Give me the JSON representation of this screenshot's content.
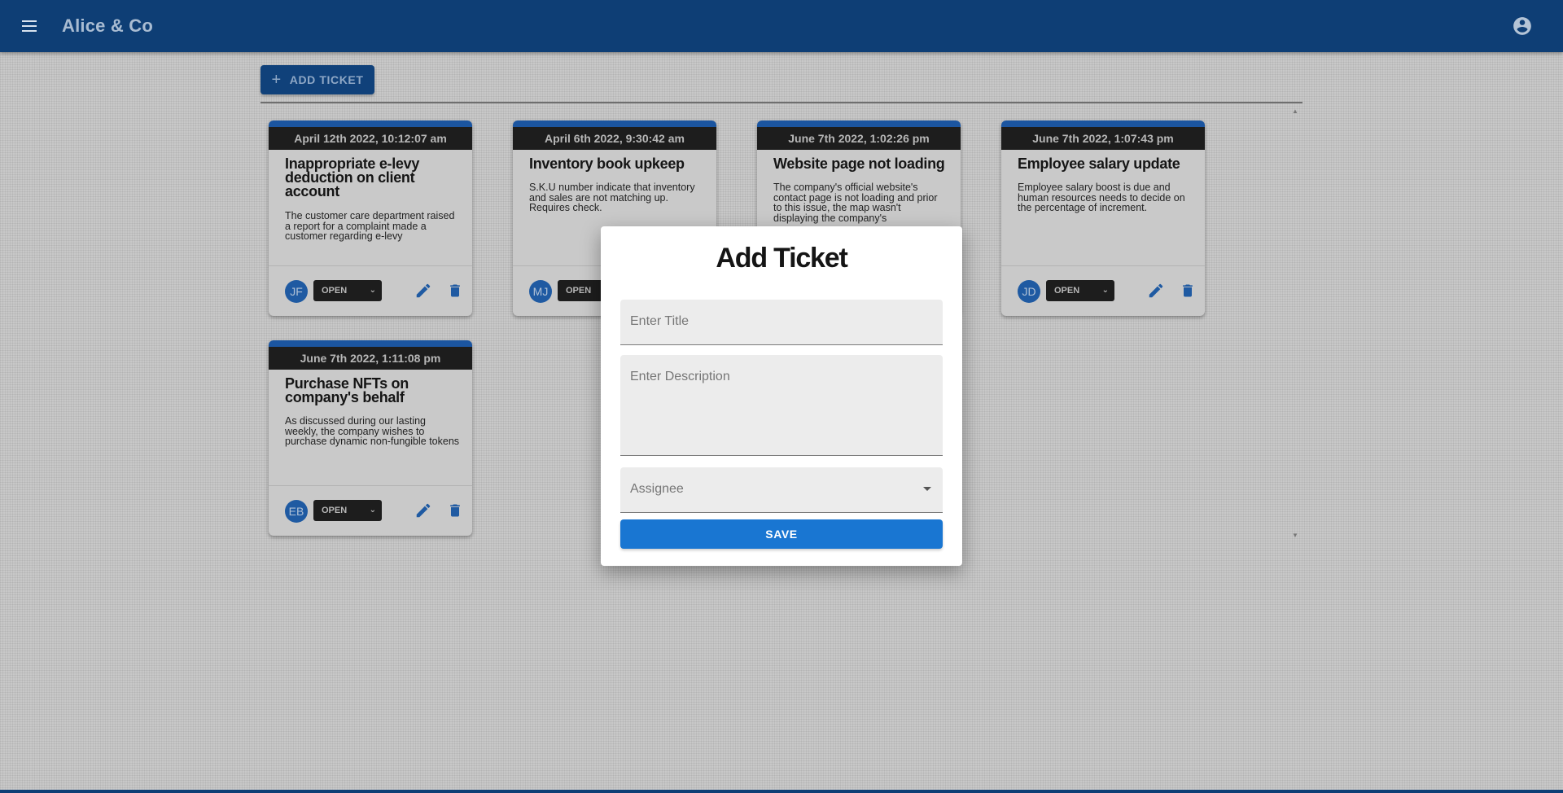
{
  "app": {
    "title": "Alice & Co",
    "menu_icon": "menu-icon",
    "account_icon": "account-circle-icon"
  },
  "toolbar": {
    "add_ticket_label": "ADD TICKET",
    "add_icon": "plus-icon"
  },
  "colors": {
    "appbar": "#0e3e75",
    "accent": "#1976d2",
    "card_accent": "#1b55a0",
    "dark_strip": "#1d1d1d"
  },
  "tickets": [
    {
      "date": "April 12th 2022, 10:12:07 am",
      "title": "Inappropriate e-levy deduction on client account",
      "description": "The customer care department raised a report for a complaint made a customer regarding e-levy",
      "assignee_initials": "JF",
      "status": "OPEN"
    },
    {
      "date": "April 6th 2022, 9:30:42 am",
      "title": "Inventory book upkeep",
      "description": "S.K.U number indicate that inventory and sales are not matching up. Requires check.",
      "assignee_initials": "MJ",
      "status": "OPEN"
    },
    {
      "date": "June 7th 2022, 1:02:26 pm",
      "title": "Website page not loading",
      "description": "The company's official website's contact page is not loading and prior to this issue, the map wasn't displaying the company's"
    },
    {
      "date": "June 7th 2022, 1:07:43 pm",
      "title": "Employee salary update",
      "description": "Employee salary boost is due and human resources needs to decide on the percentage of increment.",
      "assignee_initials": "JD",
      "status": "OPEN"
    },
    {
      "date": "June 7th 2022, 1:11:08 pm",
      "title": "Purchase NFTs on company's behalf",
      "description": "As discussed during our lasting weekly, the company wishes to purchase dynamic non-fungible tokens",
      "assignee_initials": "EB",
      "status": "OPEN"
    }
  ],
  "modal": {
    "title": "Add Ticket",
    "title_placeholder": "Enter Title",
    "description_placeholder": "Enter Description",
    "assignee_label": "Assignee",
    "save_label": "SAVE"
  }
}
